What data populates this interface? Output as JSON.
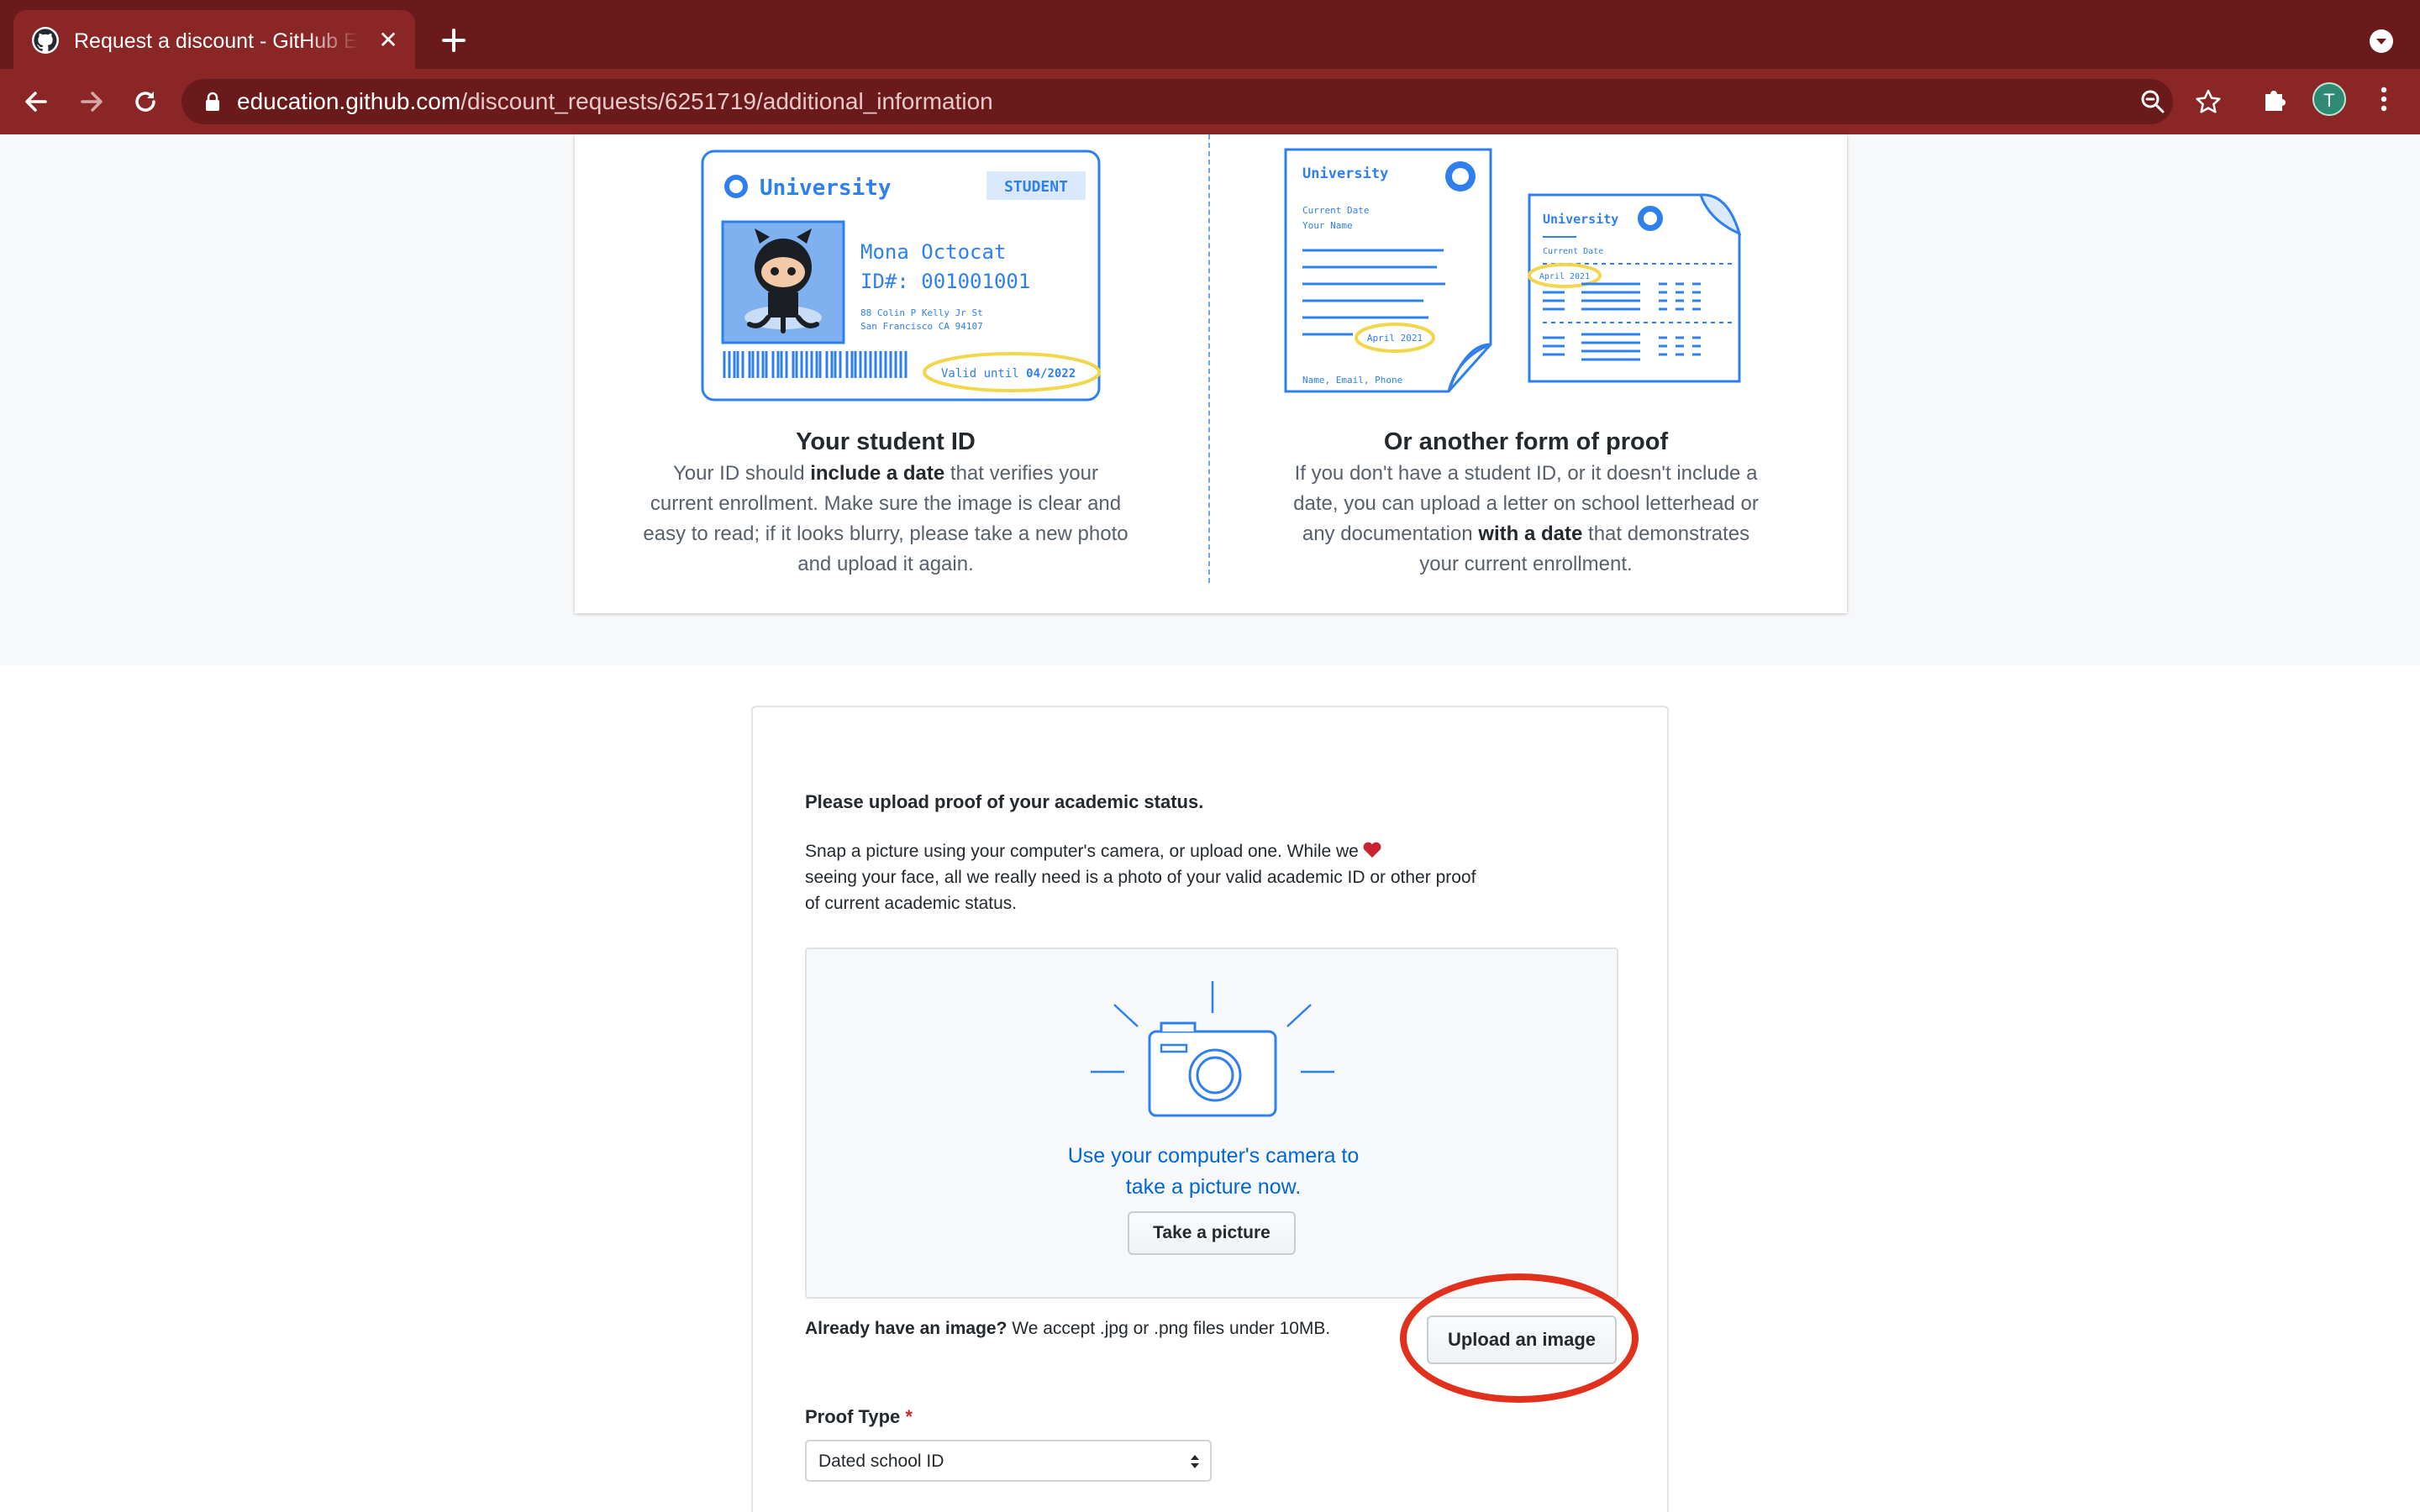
{
  "browser": {
    "tab_title": "Request a discount - GitHub Education",
    "url_host": "education.github.com",
    "url_path": "/discount_requests/6251719/additional_information",
    "profile_initial": "T",
    "theme_color": "#8a2626"
  },
  "id_card": {
    "university": "University",
    "badge": "STUDENT",
    "name": "Mona Octocat",
    "id_number": "ID#: 001001001",
    "address_line1": "88 Colin P Kelly Jr St",
    "address_line2": "San Francisco CA 94107",
    "valid_prefix": "Valid until ",
    "valid_date": "04/2022"
  },
  "letter": {
    "university": "University",
    "current_date": "Current Date",
    "your_name": "Your Name",
    "date_badge": "April 2021",
    "footer": "Name, Email, Phone",
    "second_university": "University",
    "second_current_date": "Current Date",
    "second_date_badge": "April 2021"
  },
  "student_id": {
    "heading": "Your student ID",
    "text_1": "Your ID should ",
    "bold_1": "include a date",
    "text_2": " that verifies your current enrollment. Make sure the image is clear and easy to read; if it looks blurry, please take a new photo and upload it again."
  },
  "other_proof": {
    "heading": "Or another form of proof",
    "text_1": "If you don't have a student ID, or it doesn't include a date, you can upload a letter on school letterhead or any documentation ",
    "bold_1": "with a date",
    "text_2": " that demonstrates your current enrollment."
  },
  "upload": {
    "title": "Please upload proof of your academic status.",
    "desc_1": "Snap a picture using your computer's camera, or upload one. While we",
    "desc_2": "seeing your face, all we really need is a photo of your valid academic ID or other proof of current academic status.",
    "camera_line1": "Use your computer's camera to",
    "camera_line2": "take a picture now.",
    "take_picture": "Take a picture",
    "already_bold": "Already have an image?",
    "already_text": " We accept .jpg or .png files under 10MB.",
    "upload_button": "Upload an image",
    "proof_type_label": "Proof Type",
    "required_mark": "*",
    "proof_type_value": "Dated school ID"
  },
  "colors": {
    "link_blue": "#0366d6",
    "highlight_red": "#e1301c",
    "heart": "#cb2431"
  }
}
